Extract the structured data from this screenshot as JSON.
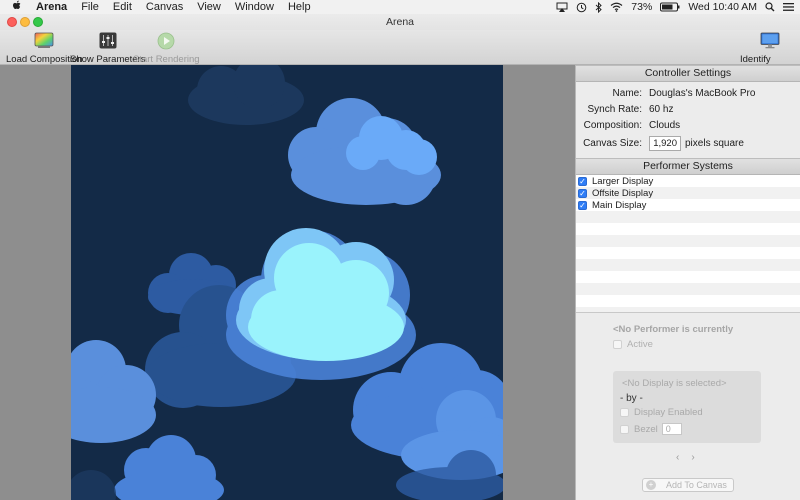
{
  "menubar": {
    "app": "Arena",
    "items": [
      "File",
      "Edit",
      "Canvas",
      "View",
      "Window",
      "Help"
    ],
    "battery": "73%",
    "clock": "Wed 10:40 AM"
  },
  "window": {
    "title": "Arena"
  },
  "toolbar": {
    "load_label": "Load Composition",
    "params_label": "Show Parameters",
    "render_label": "Start Rendering",
    "identify_label": "Identify Displays"
  },
  "controller": {
    "header": "Controller Settings",
    "name_label": "Name:",
    "name_value": "Douglas's MacBook Pro",
    "sync_label": "Synch Rate:",
    "sync_value": "60 hz",
    "comp_label": "Composition:",
    "comp_value": "Clouds",
    "size_label": "Canvas Size:",
    "size_value": "1,920",
    "size_unit": "pixels square"
  },
  "performers": {
    "header": "Performer Systems",
    "items": [
      {
        "label": "Larger Display",
        "checked": true
      },
      {
        "label": "Offsite Display",
        "checked": true
      },
      {
        "label": "Main Display",
        "checked": true
      }
    ]
  },
  "detail": {
    "no_performer": "<No Performer is currently",
    "active_label": "Active",
    "no_display": "<No Display is selected>",
    "by_label": "- by -",
    "display_enabled_label": "Display Enabled",
    "bezel_label": "Bezel",
    "bezel_value": "0",
    "prev_arrow": "‹",
    "next_arrow": "›",
    "add_label": "Add To Canvas"
  },
  "colors": {
    "canvas_bg": "#132a47",
    "cloud_blue": "#4d87d9",
    "cloud_light": "#6aa8f5",
    "cloud_glow": "#9af3fc",
    "accent": "#2f7df6"
  }
}
